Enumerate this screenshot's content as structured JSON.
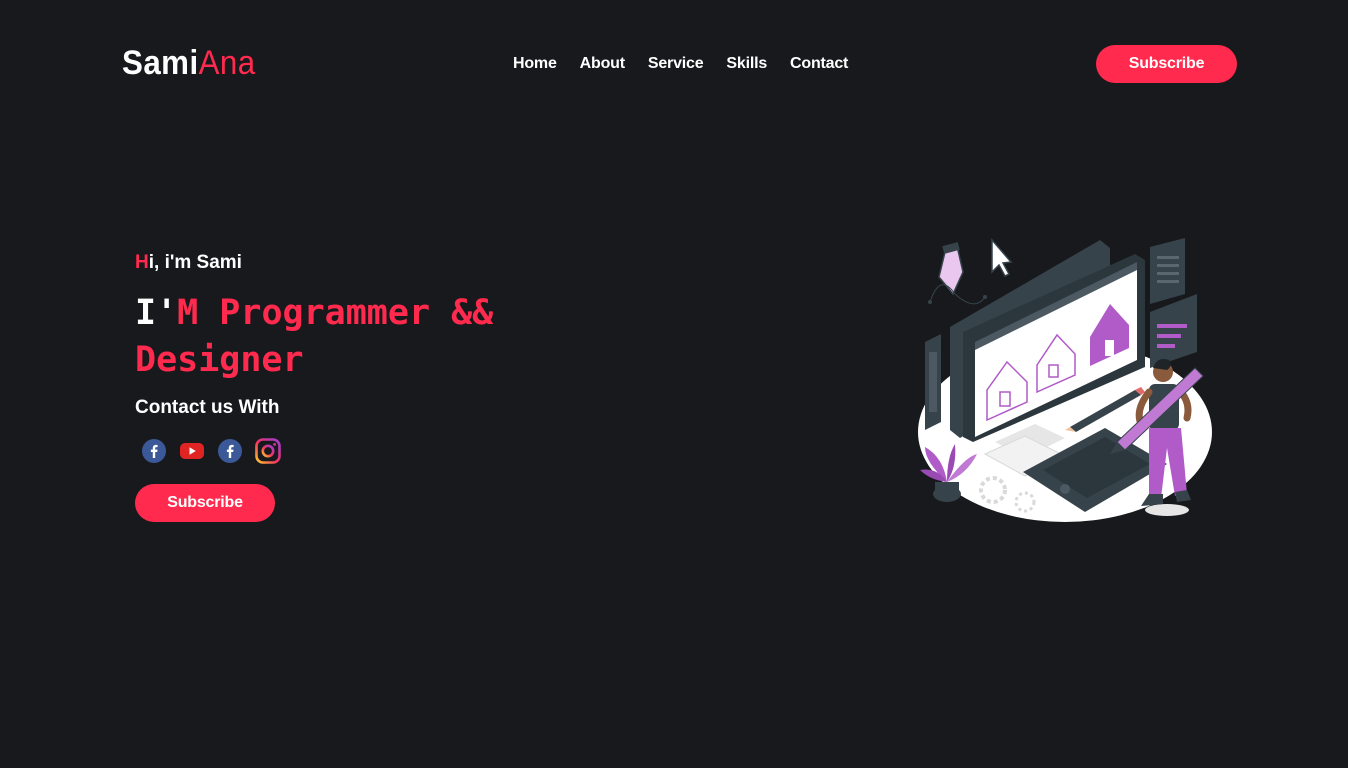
{
  "logo": {
    "first": "Sami",
    "second": "Ana"
  },
  "nav": {
    "items": [
      "Home",
      "About",
      "Service",
      "Skills",
      "Contact"
    ]
  },
  "header": {
    "subscribe_label": "Subscribe"
  },
  "hero": {
    "greeting_first": "H",
    "greeting_rest": "i, i'm Sami",
    "headline_white": "I'",
    "headline_accent": "M Programmer && Designer",
    "contact_label": "Contact us With",
    "subscribe_label": "Subscribe"
  },
  "socials": [
    "facebook-icon",
    "youtube-icon",
    "facebook-icon",
    "instagram-icon"
  ],
  "colors": {
    "background": "#17191d",
    "accent": "#ff2a4d",
    "illustration_purple": "#b05bc8",
    "illustration_dark": "#37434b"
  }
}
